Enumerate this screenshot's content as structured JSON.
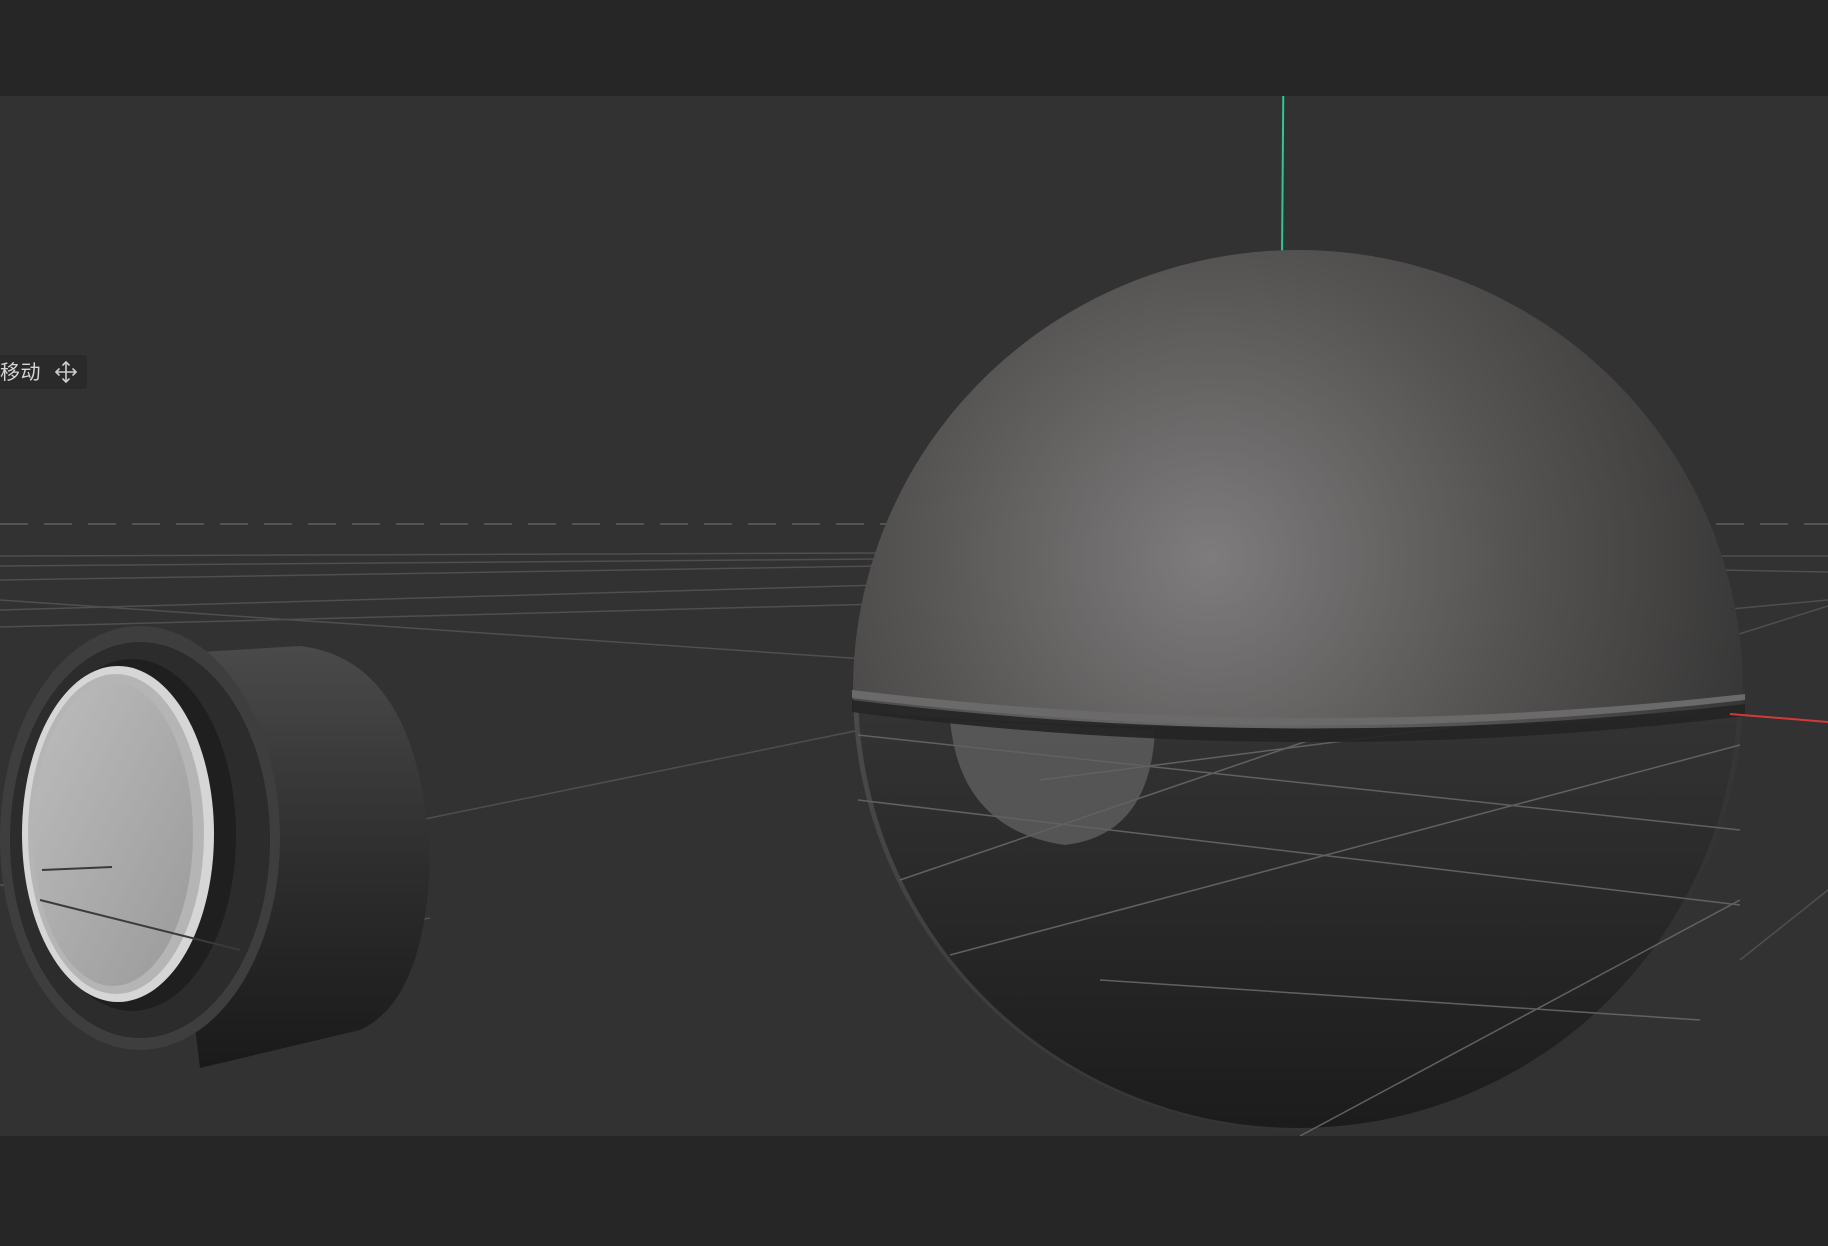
{
  "app": {
    "tool_label": "移动",
    "tool_icon": "move-arrows-icon"
  },
  "colors": {
    "chrome": "#262626",
    "viewport_background": "#323232",
    "grid_line": "#5a5a5a",
    "axis_y": "#2fc79a",
    "axis_x": "#d23a3a"
  },
  "scene": {
    "objects": [
      {
        "name": "sphere",
        "type": "sphere"
      },
      {
        "name": "cylinder-cap",
        "type": "cylinder"
      }
    ]
  }
}
